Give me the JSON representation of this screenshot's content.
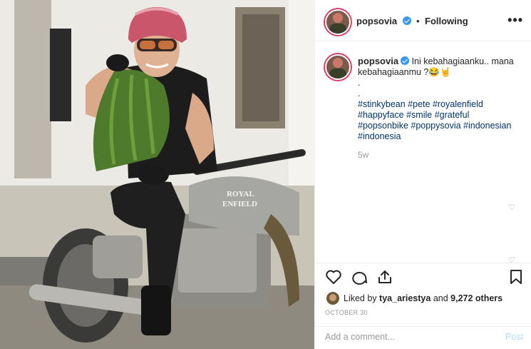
{
  "post": {
    "username": "popsovia",
    "verified": true,
    "follow_status": "Following",
    "separator": "•",
    "more_label": "•••"
  },
  "caption": {
    "username": "popsovia",
    "text": "Ini kebahagiaanku.. mana kebahagiaanmu ?😂🤘",
    "line_dot1": ".",
    "line_dot2": ".",
    "hashtags": "#stinkybean #pete #royalenfield #happyface #smile #grateful #popsonbike #poppysovia #indonesian #indonesia",
    "time_ago": "5w"
  },
  "likes": {
    "liked_by_prefix": "Liked by",
    "liked_by_user": "tya_ariestya",
    "and_text": "and",
    "count": "9,272 others"
  },
  "date": "October 30",
  "comment": {
    "placeholder": "Add a comment...",
    "post_label": "Post"
  },
  "photo": {
    "tank_brand_line1": "ROYAL",
    "tank_brand_line2": "ENFIELD"
  },
  "icons": [
    "heart-icon",
    "comment-icon",
    "share-icon",
    "bookmark-icon",
    "verified-icon",
    "more-icon"
  ],
  "colors": {
    "link": "#003569",
    "verified": "#3897f0",
    "post_disabled": "#b2dffc",
    "muted": "#999999"
  }
}
